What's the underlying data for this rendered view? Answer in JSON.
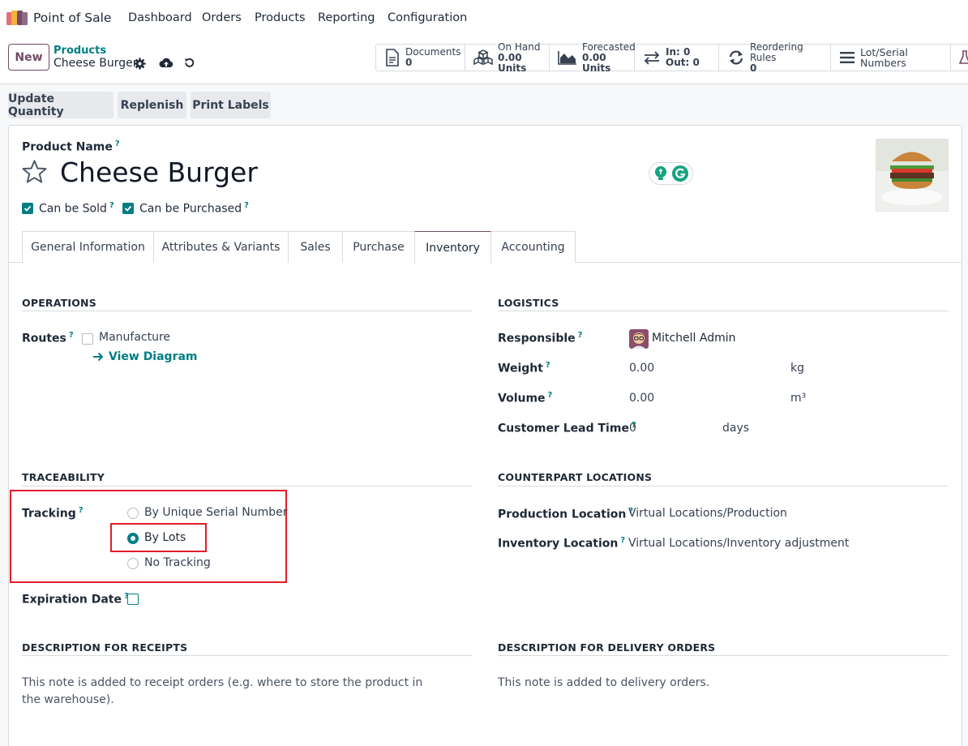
{
  "nav": {
    "app_name": "Point of Sale",
    "menu": [
      "Dashboard",
      "Orders",
      "Products",
      "Reporting",
      "Configuration"
    ]
  },
  "control": {
    "new_label": "New",
    "breadcrumb_parent": "Products",
    "breadcrumb_current": "Cheese Burger"
  },
  "stats": [
    {
      "icon": "document-icon",
      "label": "Documents",
      "value": "0"
    },
    {
      "icon": "cubes-icon",
      "label": "On Hand",
      "value": "0.00 Units"
    },
    {
      "icon": "area-chart-icon",
      "label": "Forecasted",
      "value": "0.00 Units"
    },
    {
      "icon": "exchange-icon",
      "label": "In: 0",
      "value": "Out: 0"
    },
    {
      "icon": "refresh-icon",
      "label": "Reordering Rules",
      "value": "0"
    },
    {
      "icon": "bars-icon",
      "label": "Lot/Serial Numbers",
      "value": ""
    }
  ],
  "actions": [
    "Update Quantity",
    "Replenish",
    "Print Labels"
  ],
  "product": {
    "name_label": "Product Name",
    "name": "Cheese Burger",
    "can_be_sold": "Can be Sold",
    "can_be_purchased": "Can be Purchased"
  },
  "tabs": [
    "General Information",
    "Attributes & Variants",
    "Sales",
    "Purchase",
    "Inventory",
    "Accounting"
  ],
  "active_tab": "Inventory",
  "operations": {
    "title": "OPERATIONS",
    "routes_label": "Routes",
    "manufacture": "Manufacture",
    "view_diagram": "View Diagram"
  },
  "logistics": {
    "title": "LOGISTICS",
    "responsible_label": "Responsible",
    "responsible": "Mitchell Admin",
    "weight_label": "Weight",
    "weight": "0.00",
    "weight_unit": "kg",
    "volume_label": "Volume",
    "volume": "0.00",
    "volume_unit": "m³",
    "lead_label": "Customer Lead Time",
    "lead": "0",
    "lead_unit": "days"
  },
  "traceability": {
    "title": "TRACEABILITY",
    "tracking_label": "Tracking",
    "options": [
      "By Unique Serial Number",
      "By Lots",
      "No Tracking"
    ],
    "selected": "By Lots",
    "expiration_label": "Expiration Date"
  },
  "counterpart": {
    "title": "COUNTERPART LOCATIONS",
    "production_label": "Production Location",
    "production": "Virtual Locations/Production",
    "inventory_label": "Inventory Location",
    "inventory": "Virtual Locations/Inventory adjustment"
  },
  "descriptions": {
    "receipts_title": "DESCRIPTION FOR RECEIPTS",
    "receipts_note": "This note is added to receipt orders (e.g. where to store the product in the warehouse).",
    "delivery_title": "DESCRIPTION FOR DELIVERY ORDERS",
    "delivery_note": "This note is added to delivery orders."
  },
  "colors": {
    "brand": "#714B67",
    "accent": "#017e84",
    "highlight": "#e11d2a"
  }
}
